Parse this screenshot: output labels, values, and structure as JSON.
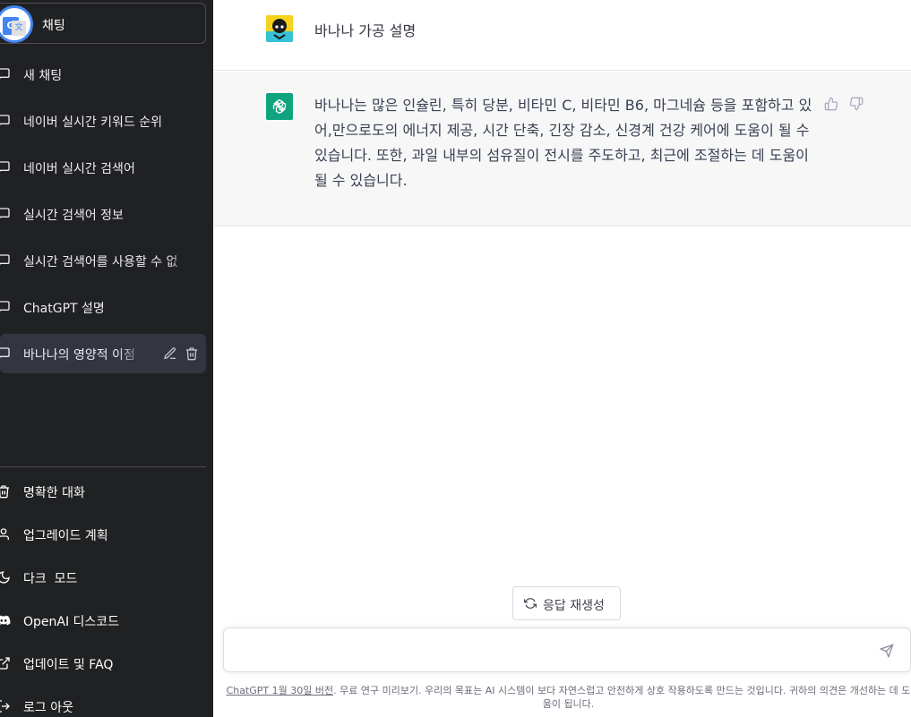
{
  "sidebar": {
    "top_button_label": "채팅",
    "conversations": [
      {
        "label": "새 채팅"
      },
      {
        "label": "네이버 실시간 키워드 순위"
      },
      {
        "label": "네이버 실시간 검색어"
      },
      {
        "label": "실시간 검색어 정보"
      },
      {
        "label": "실시간 검색어를 사용할 수 없"
      },
      {
        "label": "ChatGPT 설명"
      },
      {
        "label": "바나나의 영양적 이점"
      }
    ],
    "bottom_items": [
      {
        "label": "명확한 대화",
        "icon": "trash-icon"
      },
      {
        "label": "업그레이드 계획",
        "icon": "user-icon"
      },
      {
        "label": "다크  모드",
        "icon": "moon-icon"
      },
      {
        "label": "OpenAI 디스코드",
        "icon": "discord-icon"
      },
      {
        "label": "업데이트 및 FAQ",
        "icon": "external-link-icon"
      },
      {
        "label": "로그 아웃",
        "icon": "logout-icon"
      }
    ]
  },
  "chat": {
    "user_message": "바나나 가공 설명",
    "assistant_message": "바나나는 많은 인슐린, 특히 당분, 비타민 C, 비타민 B6, 마그네슘 등을 포함하고 있어,만으로도의 에너지 제공, 시간 단축, 긴장 감소, 신경계 건강 케어에 도움이 될 수 있습니다. 또한, 과일 내부의 섬유질이 전시를 주도하고, 최근에 조절하는 데 도움이 될 수 있습니다."
  },
  "regenerate_label": "응답 재생성",
  "input": {
    "placeholder": ""
  },
  "footer": {
    "link_text": "ChatGPT 1월 30일 버전",
    "text": ". 무료 연구 미리보기. 우리의 목표는 AI 시스템이 보다 자연스럽고 안전하게 상호 작용하도록 만드는 것입니다. 귀하의 의견은 개선하는 데 도움이 됩니다."
  },
  "colors": {
    "sidebar_bg": "#202123",
    "active_item_bg": "#343541",
    "assistant_row_bg": "#f7f7f8",
    "openai_green": "#10a37f"
  }
}
